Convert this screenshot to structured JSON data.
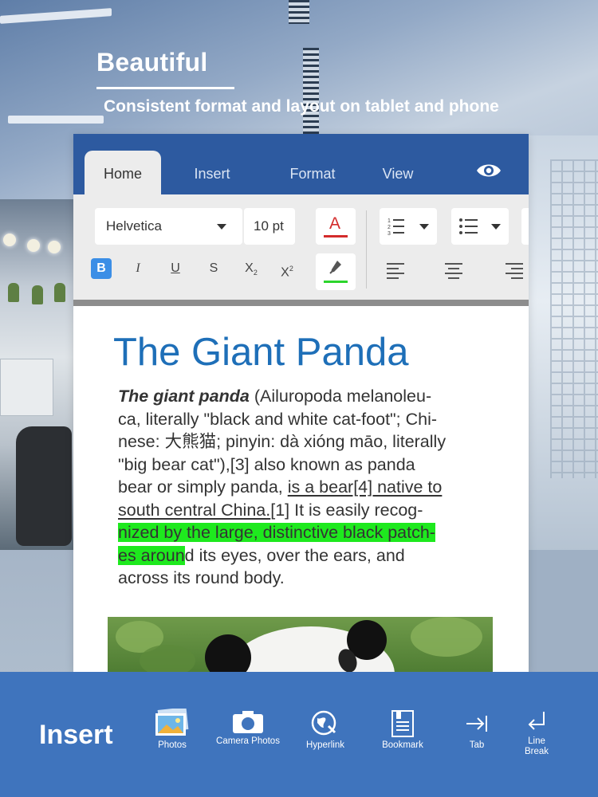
{
  "banner": {
    "headline": "Beautiful",
    "subhead": "Consistent format and layout on tablet and phone"
  },
  "toolbar": {
    "tabs": [
      {
        "label": "Home",
        "active": true
      },
      {
        "label": "Insert",
        "active": false
      },
      {
        "label": "Format",
        "active": false
      },
      {
        "label": "View",
        "active": false
      }
    ],
    "view_icon": "eye-icon",
    "font_name": "Helvetica",
    "font_size": "10 pt",
    "font_color_glyph": "A",
    "font_color": "#d32b2b",
    "highlight_color": "#2cd52c",
    "format_buttons": [
      {
        "label": "B",
        "active": true
      },
      {
        "label": "I",
        "active": false
      },
      {
        "label": "U",
        "active": false
      },
      {
        "label": "S",
        "active": false
      },
      {
        "label": "X",
        "sub": "2",
        "active": false
      },
      {
        "label": "X",
        "sup": "2",
        "active": false
      }
    ]
  },
  "document": {
    "title": "The Giant Panda",
    "lines": [
      {
        "bold": "The giant panda",
        "text": " (Ailuropoda melanoleu-"
      },
      {
        "text": "ca, literally \"black and white cat-foot\"; Chi-"
      },
      {
        "text": "nese: 大熊猫; pinyin: dà xióng māo, literally"
      },
      {
        "text": "\"big bear cat\"),[3] also known as panda"
      },
      {
        "text": "bear or simply panda, ",
        "underline": "is a bear[4] native to"
      },
      {
        "underline": "south central China.",
        "text": "[1] It is easily recog-"
      },
      {
        "highlight": "nized by the large, distinctive black patch-"
      },
      {
        "highlight": "es aroun",
        "text": "d its eyes, over the ears, and"
      },
      {
        "text": "across its round body."
      }
    ]
  },
  "insert_bar": {
    "title": "Insert",
    "items": [
      {
        "label": "Photos",
        "icon": "photos-icon"
      },
      {
        "label": "Camera Photos",
        "icon": "camera-icon"
      },
      {
        "label": "Hyperlink",
        "icon": "globe-link-icon"
      },
      {
        "label": "Bookmark",
        "icon": "bookmark-icon"
      },
      {
        "label": "Tab",
        "icon": "tab-arrow-icon"
      },
      {
        "label": "Line Break",
        "icon": "line-break-icon"
      }
    ]
  }
}
